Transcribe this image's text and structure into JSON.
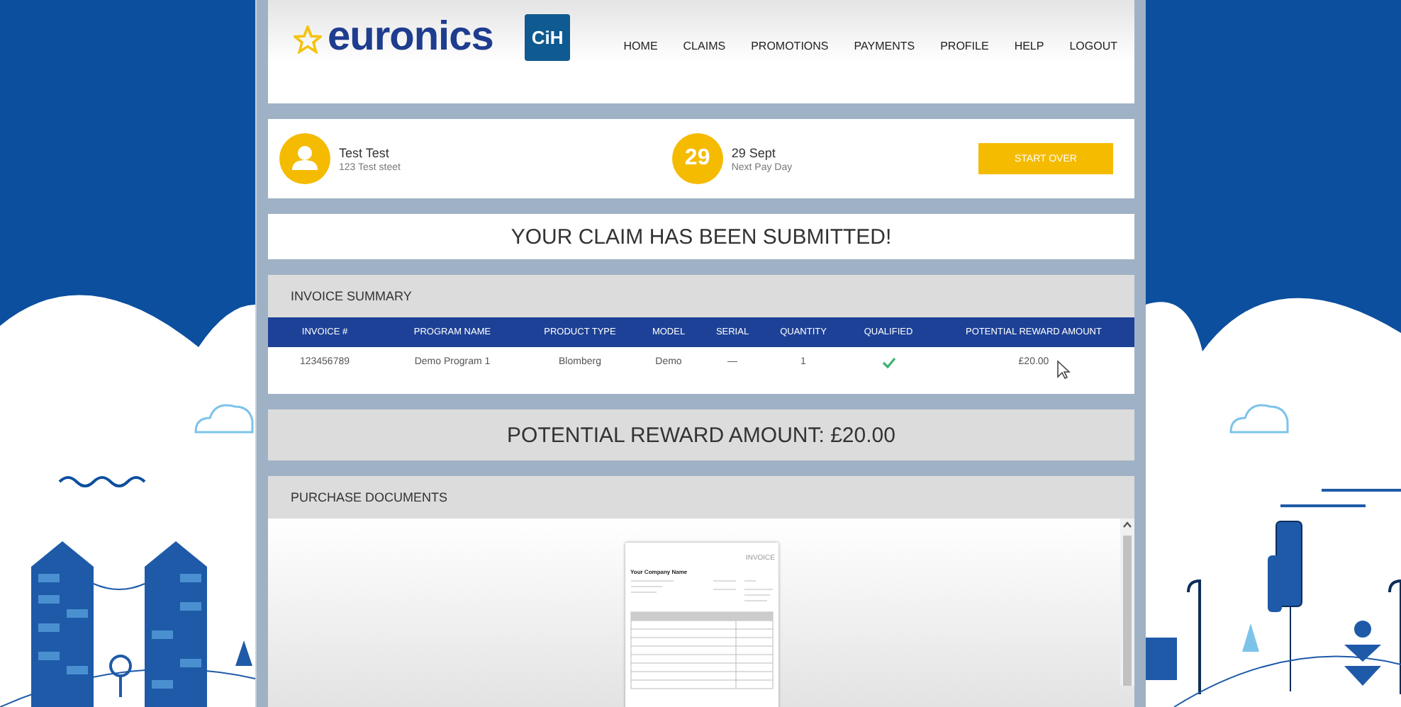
{
  "header": {
    "logo_text": "euronics",
    "badge_text": "CiH",
    "nav": [
      {
        "label": "HOME"
      },
      {
        "label": "CLAIMS"
      },
      {
        "label": "PROMOTIONS"
      },
      {
        "label": "PAYMENTS"
      },
      {
        "label": "PROFILE"
      },
      {
        "label": "HELP"
      },
      {
        "label": "LOGOUT"
      }
    ]
  },
  "user": {
    "name": "Test Test",
    "address": "123 Test steet",
    "day": "29",
    "date": "29 Sept",
    "date_caption": "Next Pay Day",
    "button": "START OVER"
  },
  "banner": "YOUR CLAIM HAS BEEN SUBMITTED!",
  "invoice_summary": {
    "title": "INVOICE SUMMARY",
    "columns": [
      "INVOICE #",
      "PROGRAM NAME",
      "PRODUCT TYPE",
      "MODEL",
      "SERIAL",
      "QUANTITY",
      "QUALIFIED",
      "POTENTIAL REWARD AMOUNT"
    ],
    "rows": [
      {
        "invoice": "123456789",
        "program": "Demo Program 1",
        "product_type": "Blomberg",
        "model": "Demo",
        "serial": "—",
        "quantity": "1",
        "qualified": true,
        "reward": "£20.00"
      }
    ]
  },
  "reward_total": "POTENTIAL REWARD AMOUNT: £20.00",
  "purchase_documents": {
    "title": "PURCHASE DOCUMENTS",
    "document": {
      "heading": "INVOICE",
      "company": "Your Company Name"
    }
  }
}
